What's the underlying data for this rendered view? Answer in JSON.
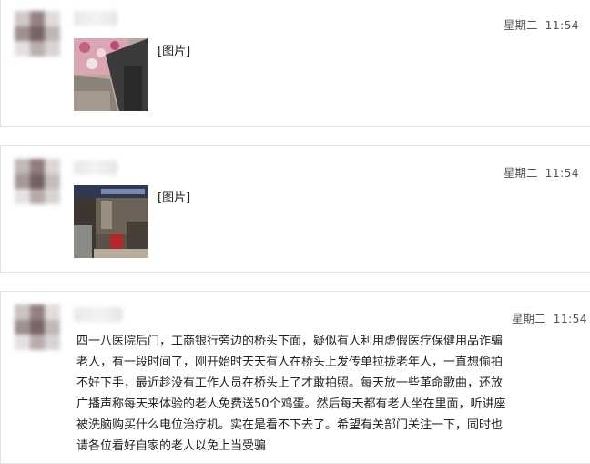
{
  "messages": [
    {
      "day": "星期二",
      "time": "11:54",
      "content": "[图片]"
    },
    {
      "day": "星期二",
      "time": "11:54",
      "content": "[图片]"
    },
    {
      "day": "星期二",
      "time": "11:54",
      "content": "四一八医院后门，工商银行旁边的桥头下面，疑似有人利用虚假医疗保健用品诈骗老人，有一段时间了，刚开始时天天有人在桥头上发传单拉拢老年人，一直想偷拍不好下手，最近趁没有工作人员在桥头上了才敢拍照。每天放一些革命歌曲，还放广播声称每天来体验的老人免费送50个鸡蛋。然后每天都有老人坐在里面，听讲座被洗脑购买什么电位治疗机。实在是看不下去了。希望有关部门关注一下，同时也请各位看好自家的老人以免上当受骗"
    }
  ]
}
